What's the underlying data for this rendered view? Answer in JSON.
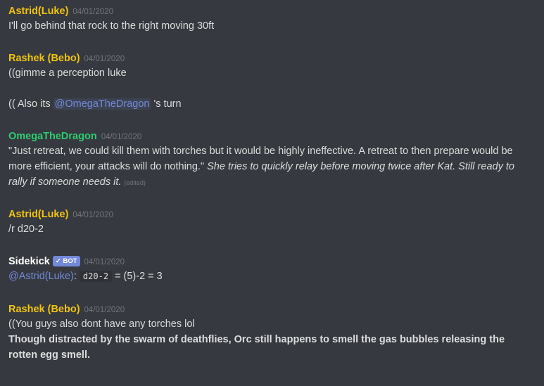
{
  "colors": {
    "background": "#36393f",
    "text": "#dcddde",
    "timestamp": "#72767d",
    "mention": "#7289da",
    "author_yellow": "#f1c40f",
    "author_green": "#2ecc71",
    "author_white": "#ffffff",
    "bot_tag": "#7289da"
  },
  "messages": [
    {
      "author": "Astrid(Luke)",
      "timestamp": "04/01/2020",
      "lines": [
        "I'll go behind that rock to the right moving 30ft"
      ]
    },
    {
      "author": "Rashek (Bebo)",
      "timestamp": "04/01/2020",
      "line1": "((gimme a perception luke",
      "line2_prefix": "(( Also its ",
      "line2_mention": "@OmegaTheDragon",
      "line2_suffix": " 's turn"
    },
    {
      "author": "OmegaTheDragon",
      "timestamp": "04/01/2020",
      "text": "\"Just retreat, we could kill them with torches but it would be highly ineffective. A retreat to then prepare would be more efficient, your attacks will do nothing.\" ",
      "italic": "She tries to quickly relay before moving twice after Kat. Still ready to rally if someone needs it.",
      "edited": "(edited)"
    },
    {
      "author": "Astrid(Luke)",
      "timestamp": "04/01/2020",
      "lines": [
        "/r d20-2"
      ]
    },
    {
      "author": "Sidekick",
      "bot_label": "BOT",
      "bot_check": "✓",
      "timestamp": "04/01/2020",
      "mention": "@Astrid(Luke)",
      "colon": ":",
      "code": "d20-2",
      "result": "= (5)-2 = 3"
    },
    {
      "author": "Rashek (Bebo)",
      "timestamp": "04/01/2020",
      "line1": "((You guys also dont have any torches lol",
      "bold": "Though distracted by the swarm of deathflies, Orc still happens to smell the gas bubbles releasing the rotten egg smell."
    }
  ]
}
